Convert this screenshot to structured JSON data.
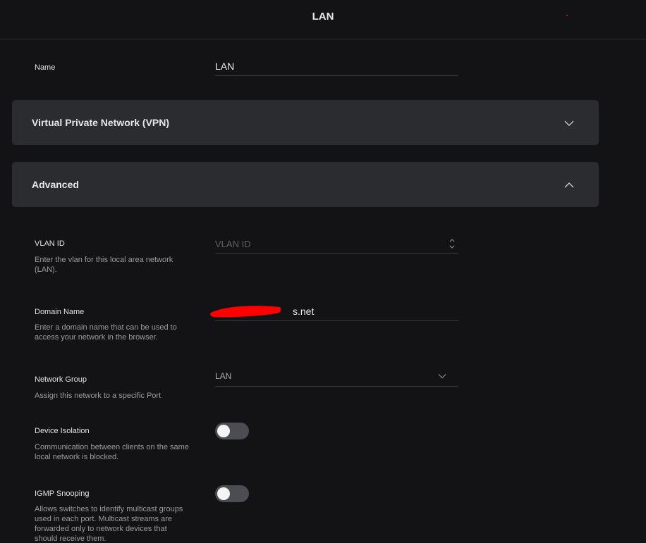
{
  "header": {
    "title": "LAN"
  },
  "name_field": {
    "label": "Name",
    "value": "LAN"
  },
  "vpn_panel": {
    "title": "Virtual Private Network (VPN)",
    "expanded": false
  },
  "advanced_panel": {
    "title": "Advanced",
    "expanded": true
  },
  "vlan": {
    "label": "VLAN ID",
    "placeholder": "VLAN ID",
    "value": "",
    "help": "Enter the vlan for this local area network (LAN)."
  },
  "domain": {
    "label": "Domain Name",
    "value": "s.net",
    "help": "Enter a domain name that can be used to access your network in the browser."
  },
  "network_group": {
    "label": "Network Group",
    "selected": "LAN",
    "help": "Assign this network to a specific Port"
  },
  "device_isolation": {
    "label": "Device Isolation",
    "enabled": false,
    "help": "Communication between clients on the same local network is blocked."
  },
  "igmp": {
    "label": "IGMP Snooping",
    "enabled": false,
    "help": "Allows switches to identify multicast groups used in each port. Multicast streams are forwarded only to network devices that should receive them."
  },
  "colors": {
    "background": "#131315",
    "panel": "#2b2c30",
    "toggle_off": "#4b4d52",
    "redaction": "#ff0000"
  }
}
